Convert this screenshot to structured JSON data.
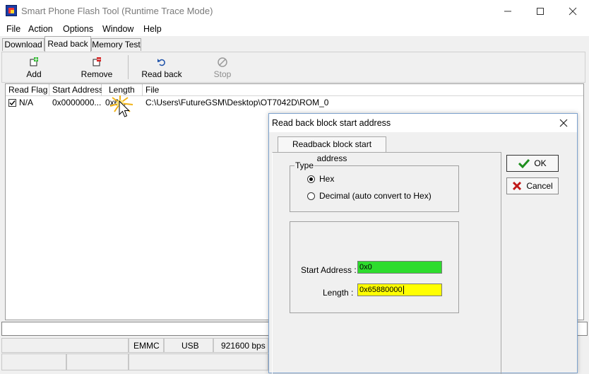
{
  "window": {
    "title": "Smart Phone Flash Tool (Runtime Trace Mode)"
  },
  "menu": {
    "items": [
      "File",
      "Action",
      "Options",
      "Window",
      "Help"
    ]
  },
  "tabs": [
    {
      "label": "Download"
    },
    {
      "label": "Read back"
    },
    {
      "label": "Memory Test"
    }
  ],
  "toolbar": {
    "add": "Add",
    "remove": "Remove",
    "readback": "Read back",
    "stop": "Stop"
  },
  "table": {
    "columns": [
      "Read Flag",
      "Start Address",
      "Length",
      "File"
    ],
    "rows": [
      {
        "flag": "N/A",
        "start": "0x0000000...",
        "length": "0x6...",
        "file": "C:\\Users\\FutureGSM\\Desktop\\OT7042D\\ROM_0",
        "checked": true
      }
    ]
  },
  "status": {
    "storage": "EMMC",
    "port": "USB",
    "baud": "921600 bps"
  },
  "dialog": {
    "title": "Read back block start address",
    "tab": "Readback block start address",
    "type_group": "Type",
    "radio_hex": "Hex",
    "radio_decimal": "Decimal (auto convert to Hex)",
    "start_label": "Start Address :",
    "start_value": "0x0",
    "length_label": "Length :",
    "length_value": "0x65880000",
    "ok": "OK",
    "cancel": "Cancel"
  },
  "colors": {
    "start_field_bg": "#2ddc2d",
    "length_field_bg": "#ffff00",
    "ok_check": "#1f8f1f",
    "cancel_x": "#c01818"
  }
}
